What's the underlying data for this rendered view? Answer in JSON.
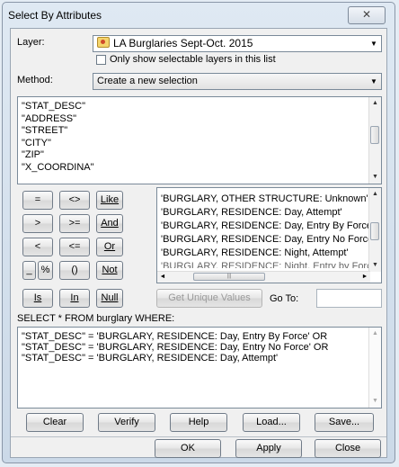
{
  "window": {
    "title": "Select By Attributes",
    "close_glyph": "✕"
  },
  "layer": {
    "label": "Layer:",
    "value": "LA Burglaries Sept-Oct. 2015",
    "checkbox_label": "Only show selectable layers in this list",
    "checked": false
  },
  "method": {
    "label": "Method:",
    "value": "Create a new selection"
  },
  "fields": [
    "\"STAT_DESC\"",
    "\"ADDRESS\"",
    "\"STREET\"",
    "\"CITY\"",
    "\"ZIP\"",
    "\"X_COORDINA\""
  ],
  "operators": {
    "eq": "=",
    "neq": "<>",
    "like": "Like",
    "gt": ">",
    "gte": ">=",
    "and": "And",
    "lt": "<",
    "lte": "<=",
    "or": "Or",
    "underscore": "_",
    "percent": "%",
    "parens": "()",
    "not": "Not",
    "is": "Is",
    "in": "In",
    "null": "Null"
  },
  "values": [
    "'BURGLARY, OTHER STRUCTURE: Unknown'",
    "'BURGLARY, RESIDENCE: Day, Attempt'",
    "'BURGLARY, RESIDENCE: Day, Entry By Force'",
    "'BURGLARY, RESIDENCE: Day, Entry No Force'",
    "'BURGLARY, RESIDENCE: Night, Attempt'",
    "'BURGLARY, RESIDENCE: Night, Entry by Force'"
  ],
  "unique_values_button": "Get Unique Values",
  "goto_label": "Go To:",
  "goto_value": "",
  "sql_prefix": "SELECT * FROM burglary WHERE:",
  "expression": [
    "\"STAT_DESC\" = 'BURGLARY, RESIDENCE: Day, Entry By Force' OR",
    "\"STAT_DESC\" = 'BURGLARY, RESIDENCE: Day, Entry No Force' OR",
    "\"STAT_DESC\" = 'BURGLARY, RESIDENCE: Day, Attempt'"
  ],
  "actions": {
    "clear": "Clear",
    "verify": "Verify",
    "help": "Help",
    "load": "Load...",
    "save": "Save..."
  },
  "footer": {
    "ok": "OK",
    "apply": "Apply",
    "close": "Close"
  }
}
